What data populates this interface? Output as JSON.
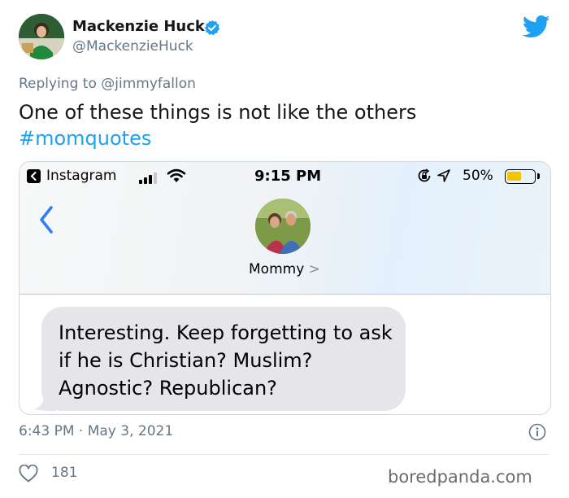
{
  "tweet": {
    "display_name": "Mackenzie Huck",
    "handle": "@MackenzieHuck",
    "reply_prefix": "Replying to",
    "reply_to": "@jimmyfallon",
    "text": "One of these things is not like the others",
    "hashtag": "#momquotes",
    "timestamp": "6:43 PM · May 3, 2021",
    "likes": "181"
  },
  "phone_screenshot": {
    "status_bar": {
      "back_app": "Instagram",
      "time": "9:15 PM",
      "battery": "50%",
      "battery_level": 0.5
    },
    "contact_name": "Mommy",
    "contact_chevron": ">",
    "message": "Interesting. Keep forgetting to ask if he is Christian? Muslim? Agnostic? Republican?"
  },
  "watermark": "boredpanda.com",
  "colors": {
    "twitter_blue": "#1da1f2",
    "secondary_text": "#657786",
    "ios_blue": "#2f7ff3",
    "bubble_gray": "#e5e5ea",
    "battery_yellow": "#f5c400"
  },
  "icons": [
    "verified-badge-icon",
    "twitter-bird-icon",
    "back-arrow-icon",
    "signal-icon",
    "wifi-icon",
    "rotation-lock-icon",
    "location-icon",
    "battery-icon",
    "chevron-left-icon",
    "info-icon",
    "heart-icon"
  ]
}
